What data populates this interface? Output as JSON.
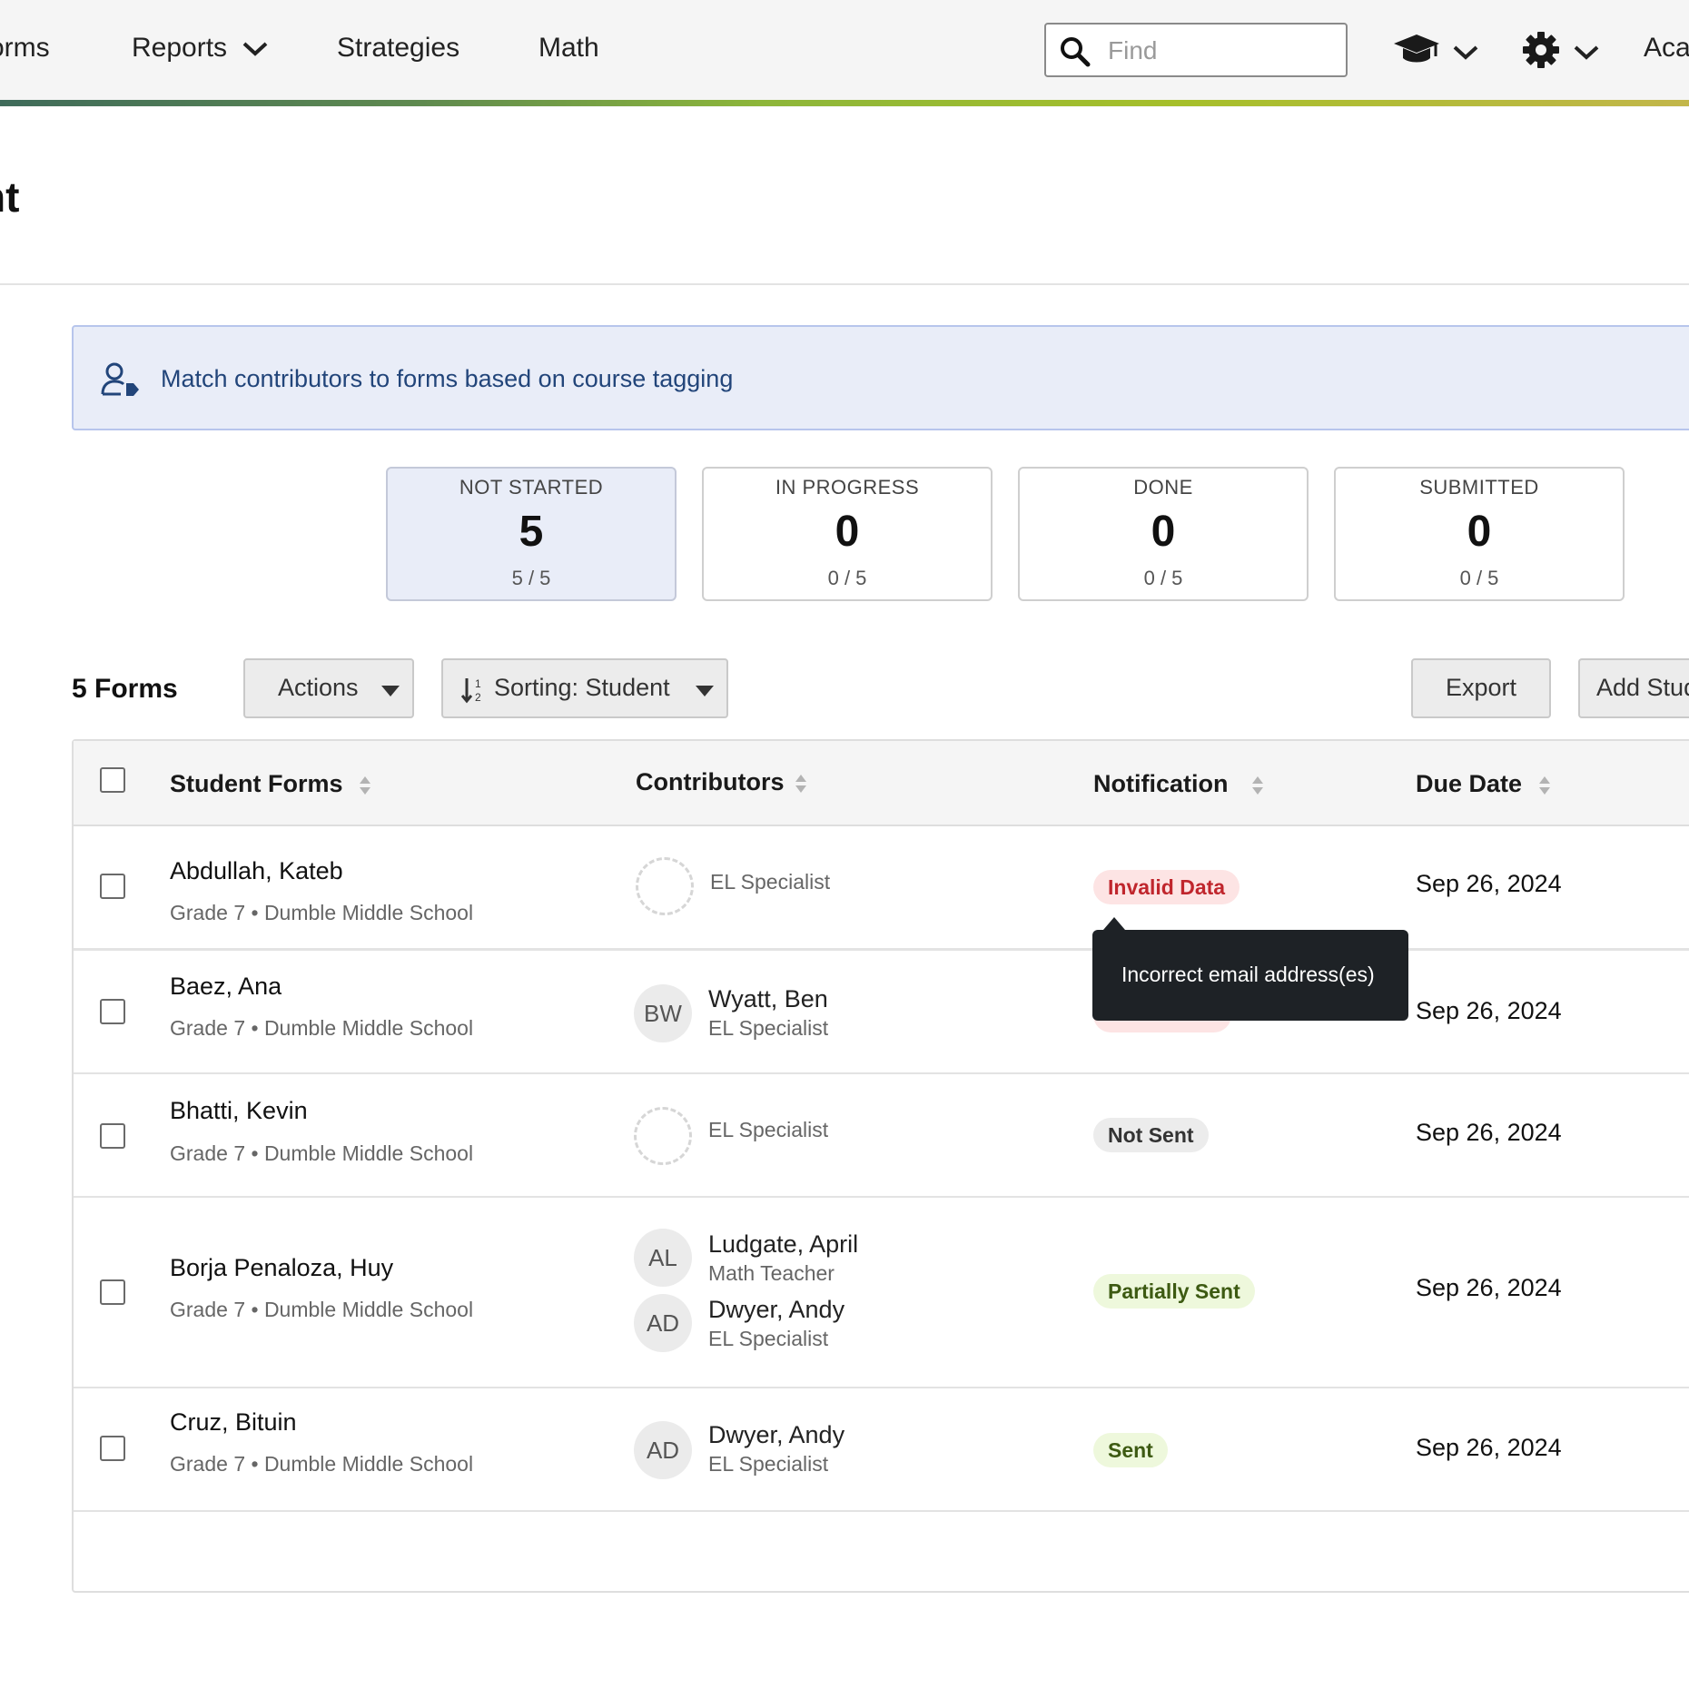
{
  "nav": {
    "items": [
      {
        "label": "orms"
      },
      {
        "label": "Reports"
      },
      {
        "label": "Strategies"
      },
      {
        "label": "Math"
      }
    ],
    "search": {
      "placeholder": "Find",
      "value": ""
    },
    "account_label": "Acac"
  },
  "page": {
    "title": "nt"
  },
  "banner": {
    "text": "Match contributors to forms based on course tagging"
  },
  "status_cards": [
    {
      "label": "NOT STARTED",
      "count": "5",
      "ratio": "5 / 5"
    },
    {
      "label": "IN PROGRESS",
      "count": "0",
      "ratio": "0 / 5"
    },
    {
      "label": "DONE",
      "count": "0",
      "ratio": "0 / 5"
    },
    {
      "label": "SUBMITTED",
      "count": "0",
      "ratio": "0 / 5"
    }
  ],
  "toolbar": {
    "forms_count": "5 Forms",
    "actions_label": "Actions",
    "sorting_label": "Sorting: Student",
    "export_label": "Export",
    "add_label": "Add Stud"
  },
  "table": {
    "headers": {
      "student_forms": "Student Forms",
      "contributors": "Contributors",
      "notification": "Notification",
      "due_date": "Due Date"
    },
    "rows": [
      {
        "name": "Abdullah, Kateb",
        "sub": "Grade 7 • Dumble Middle School",
        "contributors": [
          {
            "initials": "",
            "name": "",
            "role": "EL Specialist"
          }
        ],
        "notification": "Invalid Data",
        "due": "Sep 26, 2024"
      },
      {
        "name": "Baez, Ana",
        "sub": "Grade 7 • Dumble Middle School",
        "contributors": [
          {
            "initials": "BW",
            "name": "Wyatt, Ben",
            "role": "EL Specialist"
          }
        ],
        "notification": "",
        "due": "Sep 26, 2024"
      },
      {
        "name": "Bhatti, Kevin",
        "sub": "Grade 7 • Dumble Middle School",
        "contributors": [
          {
            "initials": "",
            "name": "",
            "role": "EL Specialist"
          }
        ],
        "notification": "Not Sent",
        "due": "Sep 26, 2024"
      },
      {
        "name": "Borja Penaloza, Huy",
        "sub": "Grade 7 • Dumble Middle School",
        "contributors": [
          {
            "initials": "AL",
            "name": "Ludgate, April",
            "role": "Math Teacher"
          },
          {
            "initials": "AD",
            "name": "Dwyer, Andy",
            "role": "EL Specialist"
          }
        ],
        "notification": "Partially Sent",
        "due": "Sep 26, 2024"
      },
      {
        "name": "Cruz, Bituin",
        "sub": "Grade 7 • Dumble Middle School",
        "contributors": [
          {
            "initials": "AD",
            "name": "Dwyer, Andy",
            "role": "EL Specialist"
          }
        ],
        "notification": "Sent",
        "due": "Sep 26, 2024"
      }
    ]
  },
  "tooltip": {
    "text": "Incorrect email address(es)"
  },
  "colors": {
    "invalid_bg": "#fde4e4",
    "invalid_fg": "#c0262d",
    "notsent_bg": "#ececec",
    "notsent_fg": "#333333",
    "partial_bg": "#eef8dc",
    "partial_fg": "#3d5a12",
    "sent_bg": "#eef8dc",
    "sent_fg": "#3d5a12",
    "banner_bg": "#e9edf8",
    "banner_text": "#22457a"
  },
  "icons": {
    "search": "search-icon",
    "cap": "graduation-cap-icon",
    "gear": "gear-icon",
    "banner": "user-tag-icon",
    "sort": "sort-icon",
    "sort_az": "sort-alpha-icon",
    "caret": "caret-down-icon"
  }
}
